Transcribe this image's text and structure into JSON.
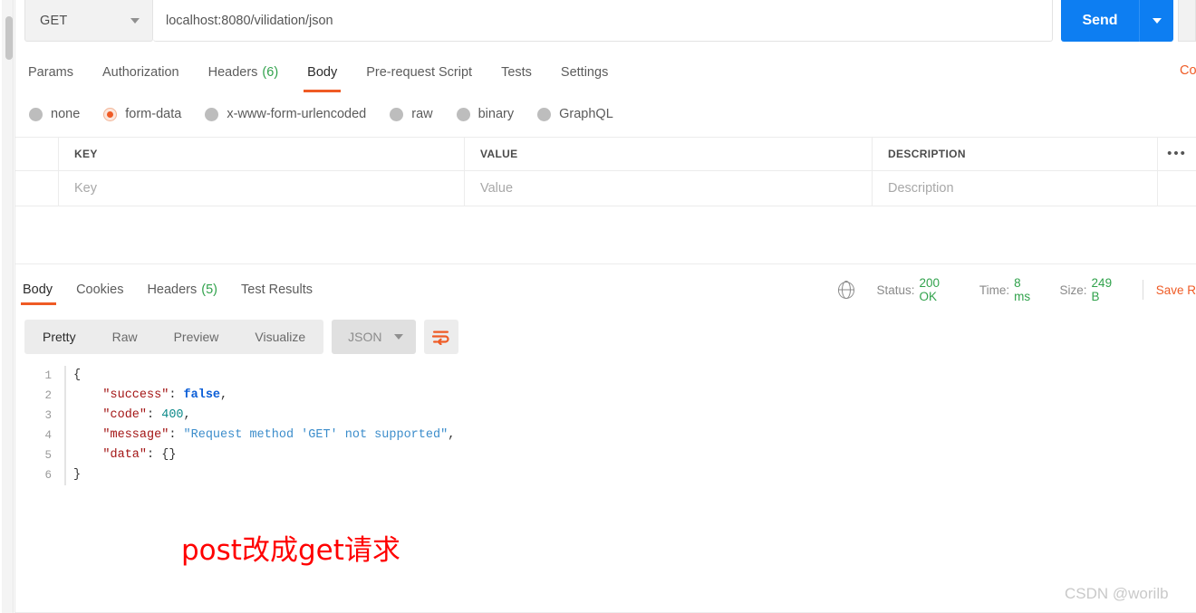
{
  "request": {
    "method": "GET",
    "url": "localhost:8080/vilidation/json",
    "send_label": "Send",
    "tabs": [
      {
        "label": "Params",
        "count": "",
        "active": false
      },
      {
        "label": "Authorization",
        "count": "",
        "active": false
      },
      {
        "label": "Headers",
        "count": "(6)",
        "active": false
      },
      {
        "label": "Body",
        "count": "",
        "active": true
      },
      {
        "label": "Pre-request Script",
        "count": "",
        "active": false
      },
      {
        "label": "Tests",
        "count": "",
        "active": false
      },
      {
        "label": "Settings",
        "count": "",
        "active": false
      }
    ],
    "cookies_link": "Co",
    "body_types": [
      {
        "label": "none",
        "selected": false
      },
      {
        "label": "form-data",
        "selected": true
      },
      {
        "label": "x-www-form-urlencoded",
        "selected": false
      },
      {
        "label": "raw",
        "selected": false
      },
      {
        "label": "binary",
        "selected": false
      },
      {
        "label": "GraphQL",
        "selected": false
      }
    ],
    "table": {
      "headers": [
        "KEY",
        "VALUE",
        "DESCRIPTION"
      ],
      "more_icon": "•••",
      "placeholders": [
        "Key",
        "Value",
        "Description"
      ]
    }
  },
  "response": {
    "tabs": [
      {
        "label": "Body",
        "count": "",
        "active": true
      },
      {
        "label": "Cookies",
        "count": "",
        "active": false
      },
      {
        "label": "Headers",
        "count": "(5)",
        "active": false
      },
      {
        "label": "Test Results",
        "count": "",
        "active": false
      }
    ],
    "status": {
      "status_label": "Status:",
      "status_value": "200 OK",
      "time_label": "Time:",
      "time_value": "8 ms",
      "size_label": "Size:",
      "size_value": "249 B",
      "save_response": "Save R"
    },
    "format_tabs": [
      {
        "label": "Pretty",
        "active": true
      },
      {
        "label": "Raw",
        "active": false
      },
      {
        "label": "Preview",
        "active": false
      },
      {
        "label": "Visualize",
        "active": false
      }
    ],
    "content_type": "JSON",
    "body_lines": [
      {
        "n": "1",
        "tokens": [
          {
            "t": "{",
            "c": "j-brace"
          }
        ]
      },
      {
        "n": "2",
        "tokens": [
          {
            "t": "    ",
            "c": "j-punct"
          },
          {
            "t": "\"success\"",
            "c": "j-key"
          },
          {
            "t": ": ",
            "c": "j-punct"
          },
          {
            "t": "false",
            "c": "j-bool"
          },
          {
            "t": ",",
            "c": "j-punct"
          }
        ]
      },
      {
        "n": "3",
        "tokens": [
          {
            "t": "    ",
            "c": "j-punct"
          },
          {
            "t": "\"code\"",
            "c": "j-key"
          },
          {
            "t": ": ",
            "c": "j-punct"
          },
          {
            "t": "400",
            "c": "j-num"
          },
          {
            "t": ",",
            "c": "j-punct"
          }
        ]
      },
      {
        "n": "4",
        "tokens": [
          {
            "t": "    ",
            "c": "j-punct"
          },
          {
            "t": "\"message\"",
            "c": "j-key"
          },
          {
            "t": ": ",
            "c": "j-punct"
          },
          {
            "t": "\"Request method 'GET' not supported\"",
            "c": "j-str"
          },
          {
            "t": ",",
            "c": "j-punct"
          }
        ]
      },
      {
        "n": "5",
        "tokens": [
          {
            "t": "    ",
            "c": "j-punct"
          },
          {
            "t": "\"data\"",
            "c": "j-key"
          },
          {
            "t": ": ",
            "c": "j-punct"
          },
          {
            "t": "{}",
            "c": "j-brace"
          }
        ]
      },
      {
        "n": "6",
        "tokens": [
          {
            "t": "}",
            "c": "j-brace"
          }
        ]
      }
    ]
  },
  "annotation": "post改成get请求",
  "watermark": "CSDN @worilb",
  "colors": {
    "accent_orange": "#ef5b25",
    "send_blue": "#0d7ef2",
    "status_green": "#31a24c",
    "annotation_red": "#ff0000"
  }
}
